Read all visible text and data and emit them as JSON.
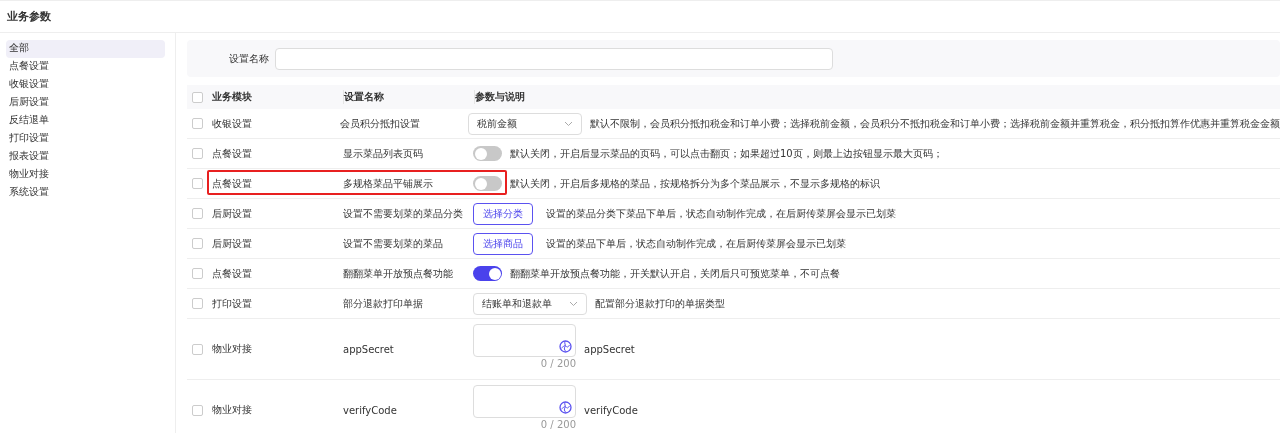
{
  "page_title": "业务参数",
  "sidebar": {
    "items": [
      {
        "label": "全部",
        "selected": true
      },
      {
        "label": "点餐设置",
        "selected": false
      },
      {
        "label": "收银设置",
        "selected": false
      },
      {
        "label": "后厨设置",
        "selected": false
      },
      {
        "label": "反结退单",
        "selected": false
      },
      {
        "label": "打印设置",
        "selected": false
      },
      {
        "label": "报表设置",
        "selected": false
      },
      {
        "label": "物业对接",
        "selected": false
      },
      {
        "label": "系统设置",
        "selected": false
      }
    ]
  },
  "search": {
    "label": "设置名称"
  },
  "table": {
    "columns": [
      "业务模块",
      "设置名称",
      "参数与说明"
    ],
    "header_checked": false,
    "rows": [
      {
        "kind": "select",
        "checked": false,
        "highlighted": false,
        "module": "收银设置",
        "name": "会员积分抵扣设置",
        "value": "税前金额",
        "description": "默认不限制，会员积分抵扣税金和订单小费；选择税前金额，会员积分不抵扣税金和订单小费；选择税前金额并重算税金，积分抵扣算作优惠并重算税金金额"
      },
      {
        "kind": "switch",
        "checked": false,
        "highlighted": false,
        "module": "点餐设置",
        "name": "显示菜品列表页码",
        "on": false,
        "description": "默认关闭，开启后显示菜品的页码，可以点击翻页；如果超过10页，则最上边按钮显示最大页码；"
      },
      {
        "kind": "switch",
        "checked": false,
        "highlighted": true,
        "module": "点餐设置",
        "name": "多规格菜品平铺展示",
        "on": false,
        "description": "默认关闭，开启后多规格的菜品，按规格拆分为多个菜品展示，不显示多规格的标识"
      },
      {
        "kind": "button",
        "checked": false,
        "highlighted": false,
        "module": "后厨设置",
        "name": "设置不需要划菜的菜品分类",
        "button": "选择分类",
        "description": "设置的菜品分类下菜品下单后，状态自动制作完成，在后厨传菜屏会显示已划菜"
      },
      {
        "kind": "button",
        "checked": false,
        "highlighted": false,
        "module": "后厨设置",
        "name": "设置不需要划菜的菜品",
        "button": "选择商品",
        "description": "设置的菜品下单后，状态自动制作完成，在后厨传菜屏会显示已划菜"
      },
      {
        "kind": "switch",
        "checked": false,
        "highlighted": false,
        "module": "点餐设置",
        "name": "翻翻菜单开放预点餐功能",
        "on": true,
        "description": "翻翻菜单开放预点餐功能，开关默认开启，关闭后只可预览菜单，不可点餐"
      },
      {
        "kind": "select",
        "checked": false,
        "highlighted": false,
        "module": "打印设置",
        "name": "部分退款打印单据",
        "value": "结账单和退款单",
        "description": "配置部分退款打印的单据类型"
      },
      {
        "kind": "textarea",
        "checked": false,
        "highlighted": false,
        "module": "物业对接",
        "name": "appSecret",
        "counter": "0 / 200",
        "description": "appSecret"
      },
      {
        "kind": "textarea",
        "checked": false,
        "highlighted": false,
        "module": "物业对接",
        "name": "verifyCode",
        "counter": "0 / 200",
        "description": "verifyCode"
      }
    ]
  }
}
